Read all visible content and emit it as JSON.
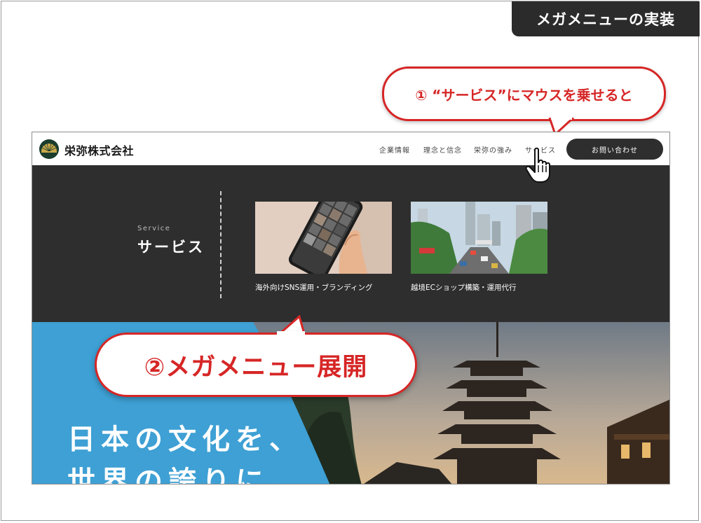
{
  "badge": "メガメニューの実装",
  "callouts": {
    "step1": "① “サービス”にマウスを乗せると",
    "step2": "②メガメニュー展開"
  },
  "site": {
    "logo_text": "栄弥株式会社",
    "nav": [
      "企業情報",
      "理念と信念",
      "栄弥の強み",
      "サービス"
    ],
    "contact_button": "お問い合わせ",
    "mega_menu": {
      "label_en": "Service",
      "label_jp": "サービス",
      "cards": [
        {
          "title": "海外向けSNS運用・ブランディング",
          "image": "smartphone-photo"
        },
        {
          "title": "越境ECショップ構築・運用代行",
          "image": "city-street-photo"
        }
      ]
    },
    "hero": {
      "line1": "日本の文化を、",
      "line2": "世界の誇りに。"
    }
  },
  "colors": {
    "accent_red": "#d62626",
    "dark": "#2e2e2e",
    "hero_blue": "#3ea0d4"
  }
}
